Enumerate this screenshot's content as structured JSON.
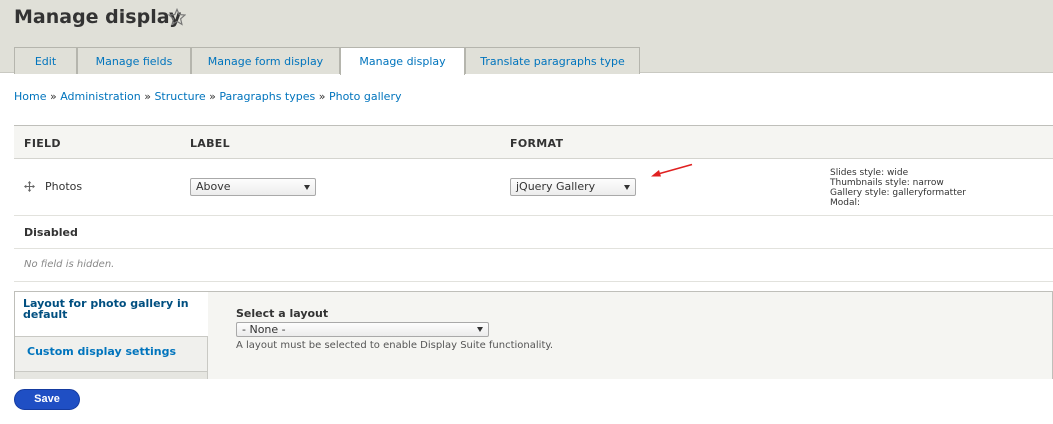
{
  "page": {
    "title": "Manage display"
  },
  "tabs": [
    {
      "label": "Edit"
    },
    {
      "label": "Manage fields"
    },
    {
      "label": "Manage form display"
    },
    {
      "label": "Manage display"
    },
    {
      "label": "Translate paragraphs type"
    }
  ],
  "active_tab": "Manage display",
  "breadcrumb": {
    "items": [
      "Home",
      "Administration",
      "Structure",
      "Paragraphs types",
      "Photo gallery"
    ],
    "separator": "»"
  },
  "table": {
    "headers": {
      "field": "FIELD",
      "label": "LABEL",
      "format": "FORMAT"
    },
    "rows": [
      {
        "field": "Photos",
        "label_value": "Above",
        "format_value": "jQuery Gallery",
        "summary": [
          "Slides style: wide",
          "Thumbnails style: narrow",
          "Gallery style: galleryformatter",
          "Modal:"
        ]
      }
    ],
    "disabled_heading": "Disabled",
    "no_hidden": "No field is hidden."
  },
  "layout_tabs": {
    "active": "Layout for photo gallery in default",
    "inactive": "Custom display settings",
    "select_label": "Select a layout",
    "select_value": "- None -",
    "description": "A layout must be selected to enable Display Suite functionality."
  },
  "actions": {
    "save": "Save"
  },
  "colors": {
    "link": "#0074bd",
    "primary_button": "#1f4fc4",
    "annotation_arrow": "#e02020"
  },
  "icons": {
    "favorite": "star-outline-icon",
    "drag": "move-arrows-icon",
    "annotation": "red-arrow-icon"
  }
}
